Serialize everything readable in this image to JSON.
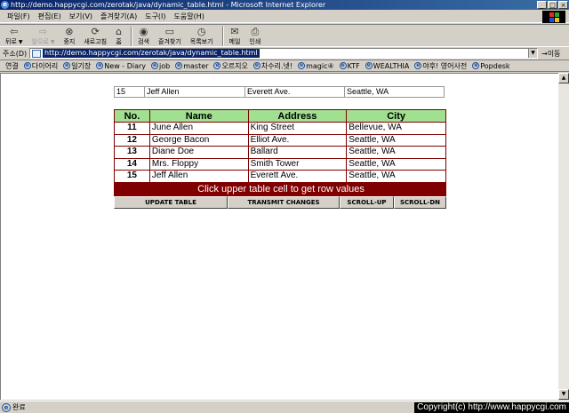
{
  "window": {
    "title": "http://demo.happycgi.com/zerotak/java/dynamic_table.html - Microsoft Internet Explorer"
  },
  "menu": [
    "파일(F)",
    "편집(E)",
    "보기(V)",
    "즐겨찾기(A)",
    "도구(I)",
    "도움말(H)"
  ],
  "toolbar": {
    "back": "뒤로",
    "forward": "앞으로",
    "stop": "중지",
    "refresh": "새로고침",
    "home": "홈",
    "search": "검색",
    "favorites": "즐겨찾기",
    "history": "목록보기",
    "mail": "메일",
    "print": "인쇄"
  },
  "address": {
    "label": "주소(D)",
    "url": "http://demo.happycgi.com/zerotak/java/dynamic_table.html",
    "go": "→이동"
  },
  "links": {
    "label": "연결",
    "items": [
      "다이어리",
      "일기장",
      "New - Diary",
      "job",
      "master",
      "오르지오",
      "차수리.넷!",
      "magic④",
      "KTF",
      "WEALTHIA",
      "야후! 영어사전",
      "Popdesk"
    ]
  },
  "selected_row": {
    "no": "15",
    "name": "Jeff Allen",
    "address": "Everett Ave.",
    "city": "Seattle, WA"
  },
  "table": {
    "headers": [
      "No.",
      "Name",
      "Address",
      "City"
    ],
    "rows": [
      [
        "11",
        "June Allen",
        "King Street",
        "Bellevue, WA"
      ],
      [
        "12",
        "George Bacon",
        "Elliot Ave.",
        "Seattle, WA"
      ],
      [
        "13",
        "Diane Doe",
        "Ballard",
        "Seattle, WA"
      ],
      [
        "14",
        "Mrs. Floppy",
        "Smith Tower",
        "Seattle, WA"
      ],
      [
        "15",
        "Jeff Allen",
        "Everett Ave.",
        "Seattle, WA"
      ]
    ],
    "footer": "Click upper table cell to get row values"
  },
  "actions": {
    "update": "UPDATE TABLE",
    "transmit": "TRANSMIT CHANGES",
    "scroll_up": "SCROLL-UP",
    "scroll_down": "SCROLL-DN"
  },
  "status": {
    "text": "완료",
    "copyright": "Copyright(c) http://www.happycgi.com"
  },
  "colors": {
    "header_bg": "#a0e090",
    "border": "#800000",
    "footer_bg": "#800000"
  }
}
